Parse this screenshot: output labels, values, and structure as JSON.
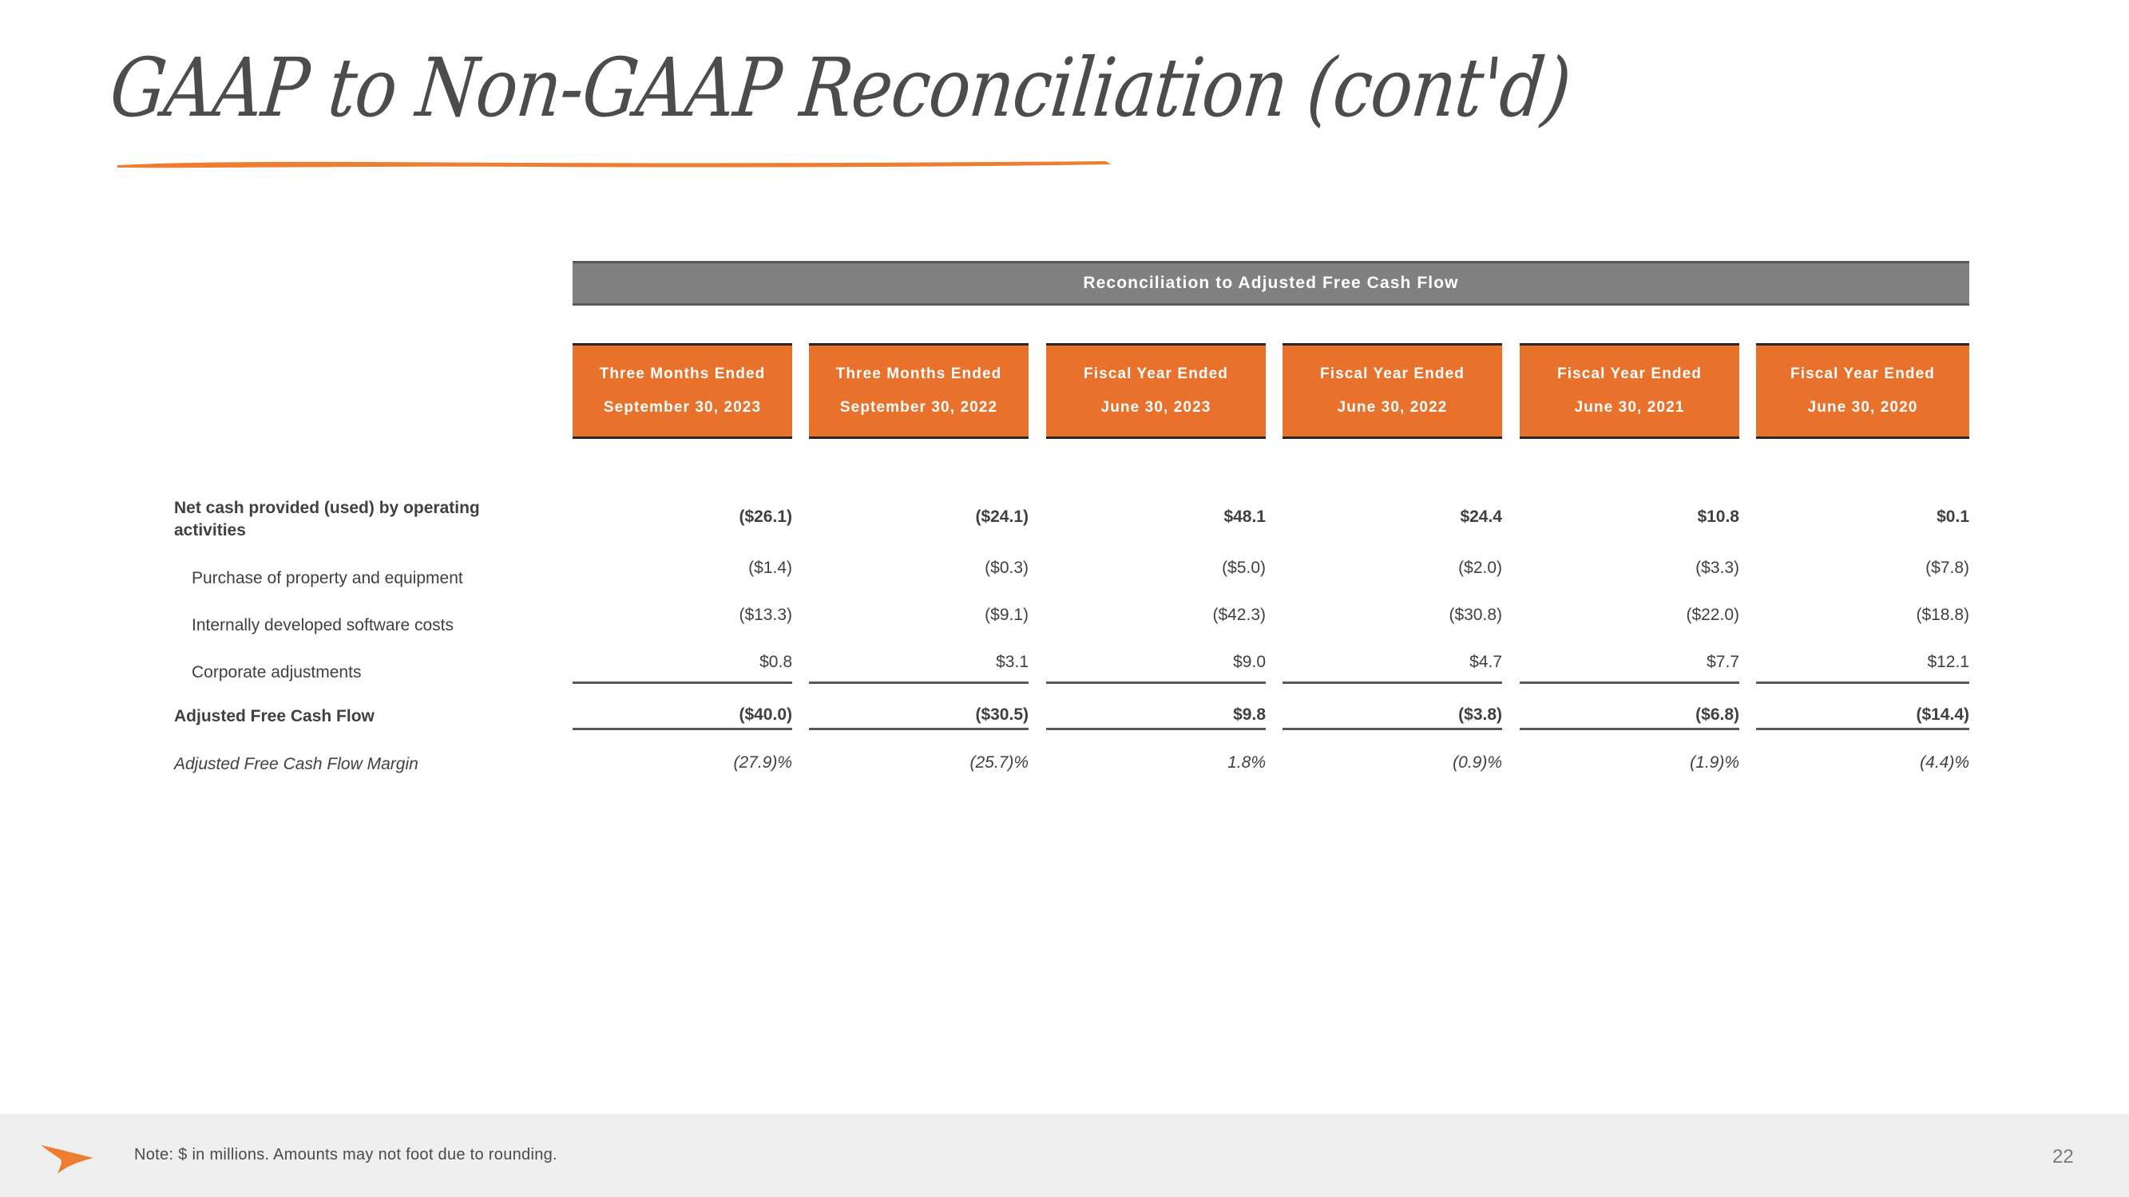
{
  "slide": {
    "title": "GAAP to Non-GAAP Reconciliation (cont'd)",
    "page_number": "22",
    "accent_color": "#E8722B",
    "banner_color": "#808080",
    "text_color": "#404040",
    "footer_band_color": "#EFEFEF"
  },
  "footer": {
    "note": "Note: $ in millions. Amounts may not foot due to rounding.",
    "logo_icon": "swoosh-arrow-icon"
  },
  "table": {
    "banner_label": "Reconciliation to Adjusted Free Cash Flow",
    "columns": [
      {
        "period": "Three Months Ended",
        "date": "September 30, 2023"
      },
      {
        "period": "Three Months Ended",
        "date": "September 30, 2022"
      },
      {
        "period": "Fiscal Year Ended",
        "date": "June 30, 2023"
      },
      {
        "period": "Fiscal Year Ended",
        "date": "June 30, 2022"
      },
      {
        "period": "Fiscal Year Ended",
        "date": "June 30, 2021"
      },
      {
        "period": "Fiscal Year Ended",
        "date": "June 30, 2020"
      }
    ],
    "rows": [
      {
        "label": "Net cash provided (used) by operating activities",
        "style": "bold",
        "values": [
          "($26.1)",
          "($24.1)",
          "$48.1",
          "$24.4",
          "$10.8",
          "$0.1"
        ]
      },
      {
        "label": "Purchase of property and equipment",
        "style": "indent",
        "values": [
          "($1.4)",
          "($0.3)",
          "($5.0)",
          "($2.0)",
          "($3.3)",
          "($7.8)"
        ]
      },
      {
        "label": "Internally developed software costs",
        "style": "indent",
        "values": [
          "($13.3)",
          "($9.1)",
          "($42.3)",
          "($30.8)",
          "($22.0)",
          "($18.8)"
        ]
      },
      {
        "label": "Corporate adjustments",
        "style": "indent",
        "values": [
          "$0.8",
          "$3.1",
          "$9.0",
          "$4.7",
          "$7.7",
          "$12.1"
        ]
      },
      {
        "label": "Adjusted Free Cash Flow",
        "style": "bold total",
        "values": [
          "($40.0)",
          "($30.5)",
          "$9.8",
          "($3.8)",
          "($6.8)",
          "($14.4)"
        ]
      },
      {
        "label": "Adjusted Free Cash Flow Margin",
        "style": "italic",
        "values": [
          "(27.9)%",
          "(25.7)%",
          "1.8%",
          "(0.9)%",
          "(1.9)%",
          "(4.4)%"
        ]
      }
    ]
  }
}
